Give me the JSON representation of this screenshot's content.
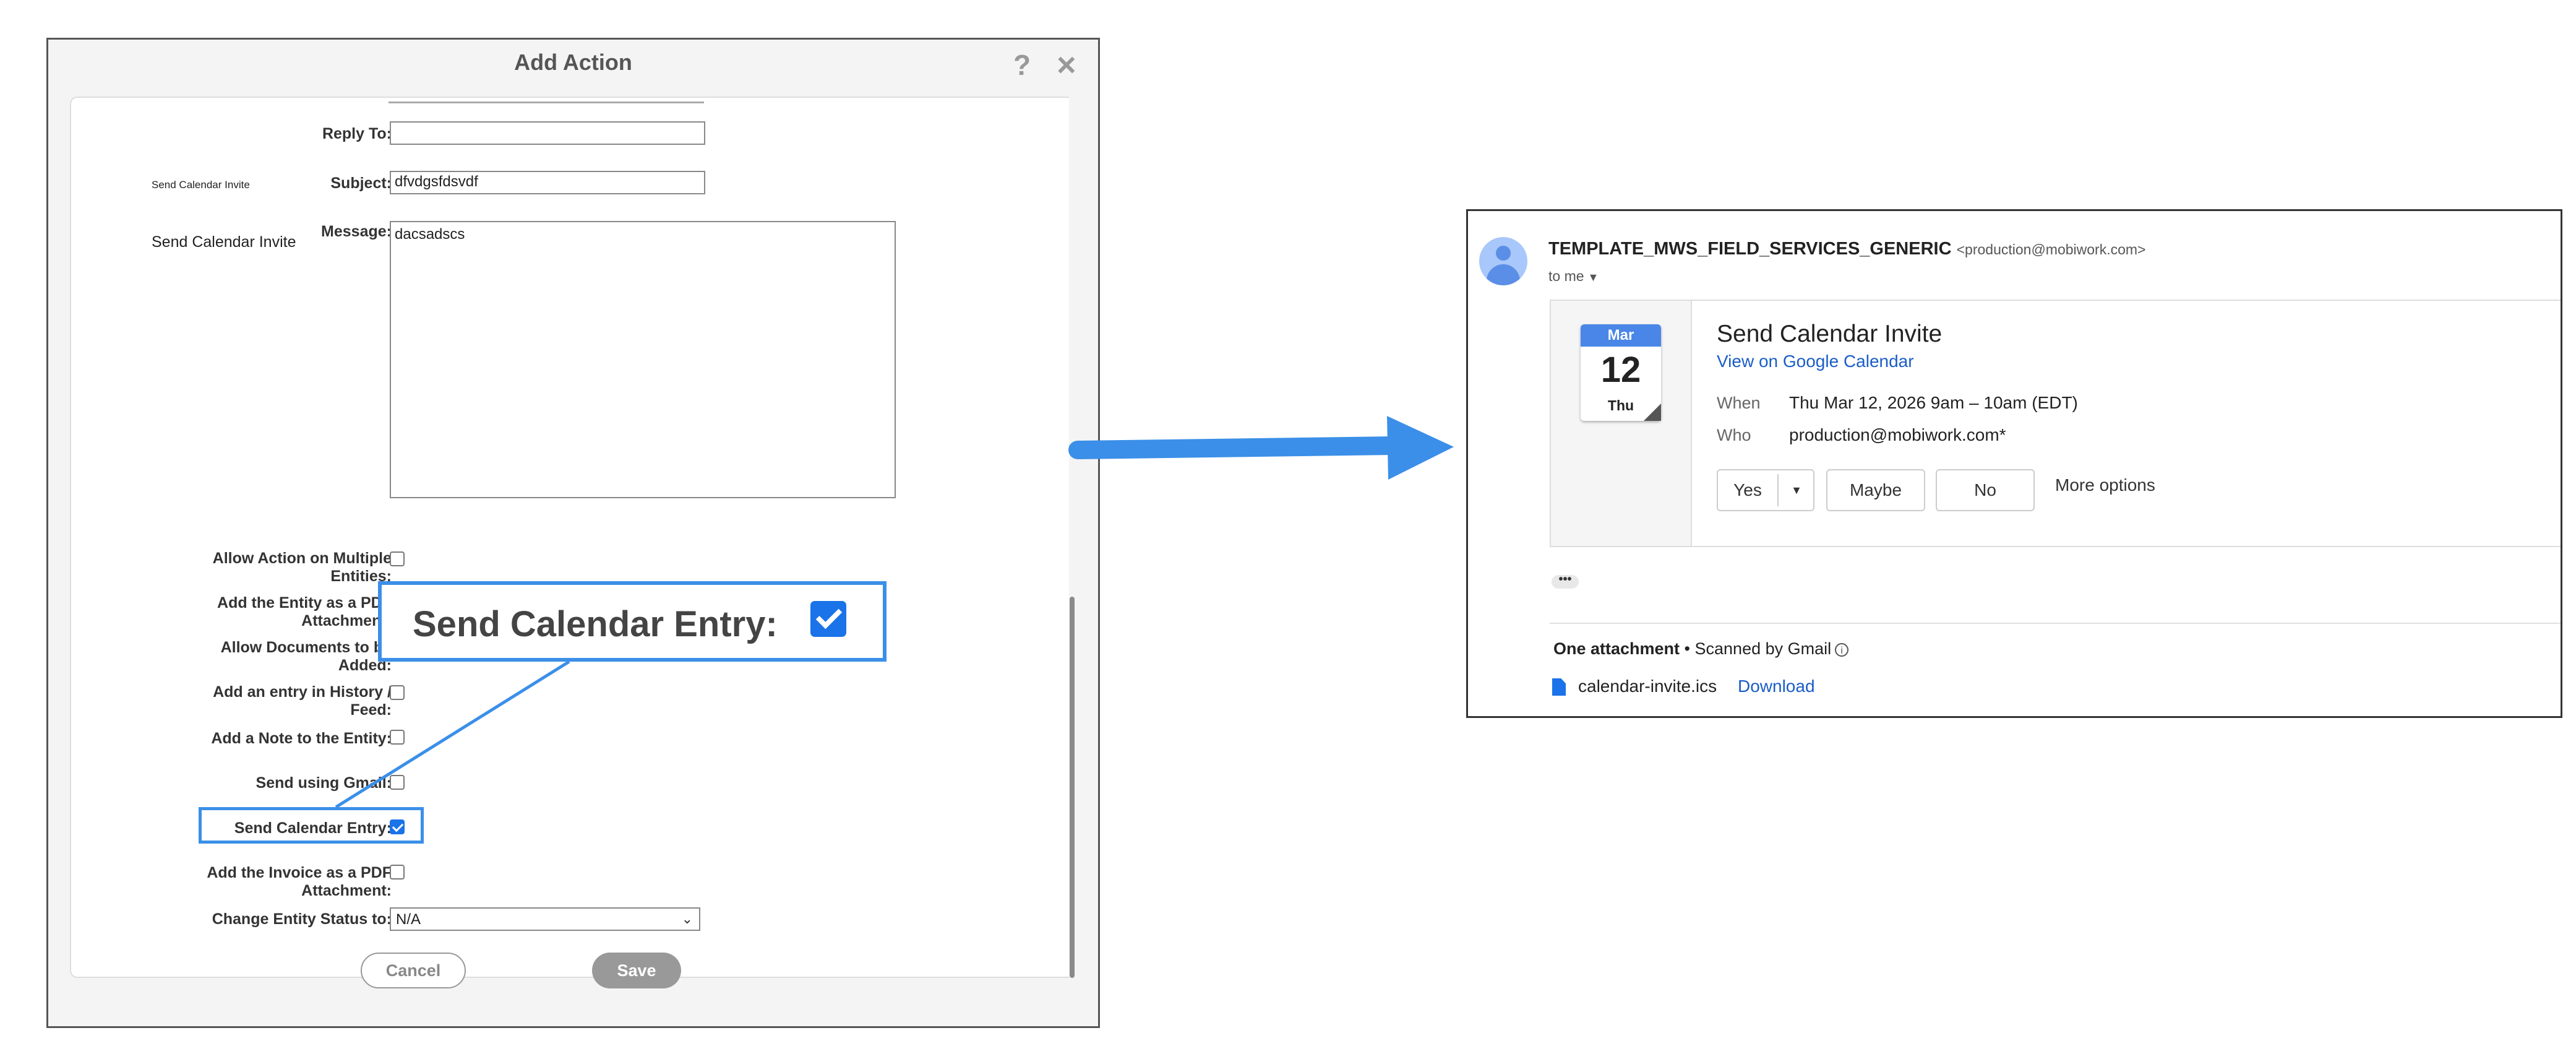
{
  "dialog": {
    "title": "Add Action",
    "help_icon": "question-icon",
    "close_icon": "close-icon",
    "fields": {
      "reply_to_label": "Reply To:",
      "reply_to_value": "",
      "subject_label": "Subject:",
      "subject_value": "dfvdgsfdsvdf",
      "message_label": "Message:",
      "message_value": "dacsadscs"
    },
    "side_notes": [
      "Send Calendar Invite",
      "Send Calendar Invite"
    ],
    "options": [
      {
        "label": "Allow Action on Multiple Entities:",
        "checked": false
      },
      {
        "label": "Add the Entity as a PDF Attachment:",
        "checked": false
      },
      {
        "label": "Allow Documents to be Added:",
        "checked": false
      },
      {
        "label": "Add an entry in History / Feed:",
        "checked": false
      },
      {
        "label": "Add a Note to the Entity:",
        "checked": false
      },
      {
        "label": "Send using Gmail:",
        "checked": false
      },
      {
        "label": "Send Calendar Entry:",
        "checked": true
      },
      {
        "label": "Add the Invoice as a PDF Attachment:",
        "checked": false
      }
    ],
    "status_label": "Change Entity Status to:",
    "status_value": "N/A",
    "cancel_label": "Cancel",
    "save_label": "Save"
  },
  "callout": {
    "text": "Send Calendar Entry:",
    "checked": true,
    "color": "#3b8fe8"
  },
  "email": {
    "sender_name": "TEMPLATE_MWS_FIELD_SERVICES_GENERIC",
    "sender_email": "<production@mobiwork.com>",
    "to": "to me",
    "event": {
      "month": "Mar",
      "day": "12",
      "weekday": "Thu",
      "title": "Send Calendar Invite",
      "link": "View on Google Calendar",
      "when_label": "When",
      "when_value": "Thu Mar 12, 2026 9am – 10am (EDT)",
      "who_label": "Who",
      "who_value": "production@mobiwork.com*",
      "rsvp": {
        "yes": "Yes",
        "maybe": "Maybe",
        "no": "No",
        "more": "More options"
      }
    },
    "ellipsis": "•••",
    "attachment": {
      "heading": "One attachment",
      "separator": " • ",
      "scanned": "Scanned by Gmail",
      "file": "calendar-invite.ics",
      "download": "Download"
    }
  },
  "colors": {
    "accent": "#3b8fe8",
    "link": "#1a5dc8",
    "checkbox": "#1a73e8"
  }
}
